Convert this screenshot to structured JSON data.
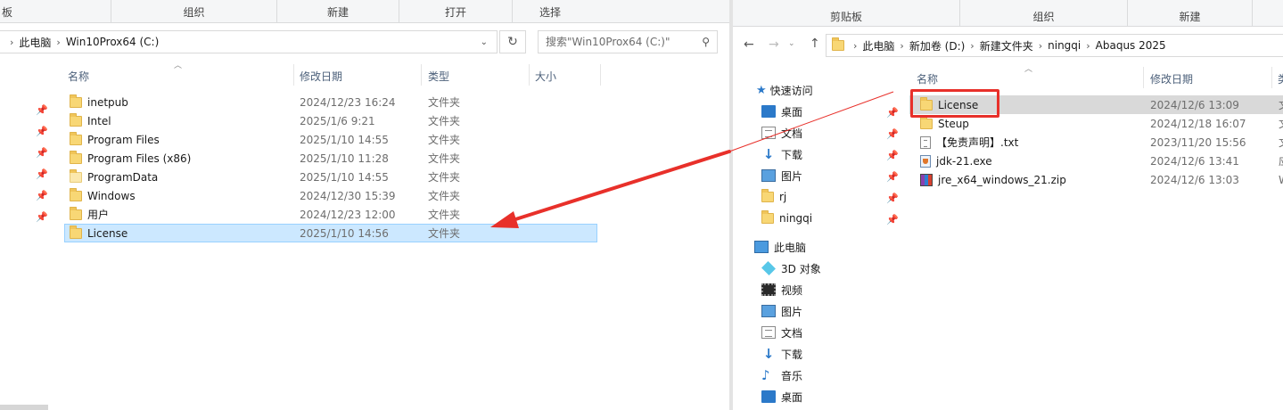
{
  "left": {
    "ribbon": {
      "tab_cut": "板",
      "group_organize": "组织",
      "group_new": "新建",
      "group_open": "打开",
      "group_select": "选择"
    },
    "breadcrumb": [
      "此电脑",
      "Win10Prox64 (C:)"
    ],
    "search_placeholder": "搜索\"Win10Prox64 (C:)\"",
    "columns": {
      "name": "名称",
      "date": "修改日期",
      "type": "类型",
      "size": "大小"
    },
    "files": [
      {
        "name": "inetpub",
        "date": "2024/12/23 16:24",
        "type": "文件夹"
      },
      {
        "name": "Intel",
        "date": "2025/1/6 9:21",
        "type": "文件夹"
      },
      {
        "name": "Program Files",
        "date": "2025/1/10 14:55",
        "type": "文件夹"
      },
      {
        "name": "Program Files (x86)",
        "date": "2025/1/10 11:28",
        "type": "文件夹"
      },
      {
        "name": "ProgramData",
        "date": "2025/1/10 14:55",
        "type": "文件夹"
      },
      {
        "name": "Windows",
        "date": "2024/12/30 15:39",
        "type": "文件夹"
      },
      {
        "name": "用户",
        "date": "2024/12/23 12:00",
        "type": "文件夹"
      },
      {
        "name": "License",
        "date": "2025/1/10 14:56",
        "type": "文件夹"
      }
    ]
  },
  "right": {
    "ribbon": {
      "group_clipboard": "剪贴板",
      "group_organize": "组织",
      "group_new": "新建"
    },
    "breadcrumb": [
      "此电脑",
      "新加卷 (D:)",
      "新建文件夹",
      "ningqi",
      "Abaqus 2025"
    ],
    "columns": {
      "name": "名称",
      "date": "修改日期",
      "type_partial": "类"
    },
    "nav": {
      "quick_access": "快速访问",
      "quick_items": [
        "桌面",
        "文档",
        "下载",
        "图片",
        "rj",
        "ningqi"
      ],
      "this_pc": "此电脑",
      "pc_items": [
        "3D 对象",
        "视频",
        "图片",
        "文档",
        "下载",
        "音乐",
        "桌面"
      ]
    },
    "files": [
      {
        "name": "License",
        "date": "2024/12/6 13:09",
        "type": "文"
      },
      {
        "name": "Steup",
        "date": "2024/12/18 16:07",
        "type": "文"
      },
      {
        "name": "【免责声明】.txt",
        "date": "2023/11/20 15:56",
        "type": "文"
      },
      {
        "name": "jdk-21.exe",
        "date": "2024/12/6 13:41",
        "type": "应"
      },
      {
        "name": "jre_x64_windows_21.zip",
        "date": "2024/12/6 13:03",
        "type": "W"
      }
    ]
  },
  "colors": {
    "selected_row": "#cce8ff",
    "selected_border": "#99d1ff",
    "highlight_row": "#d9d9d9",
    "annotation_red": "#e8302a",
    "link_blue": "#2b79c9"
  },
  "icons": {
    "up": "arrow-up-icon",
    "back": "arrow-left-icon",
    "forward": "arrow-right-icon",
    "refresh": "refresh-icon",
    "search": "search-icon",
    "dropdown": "chevron-down-icon",
    "pin": "pin-icon"
  }
}
